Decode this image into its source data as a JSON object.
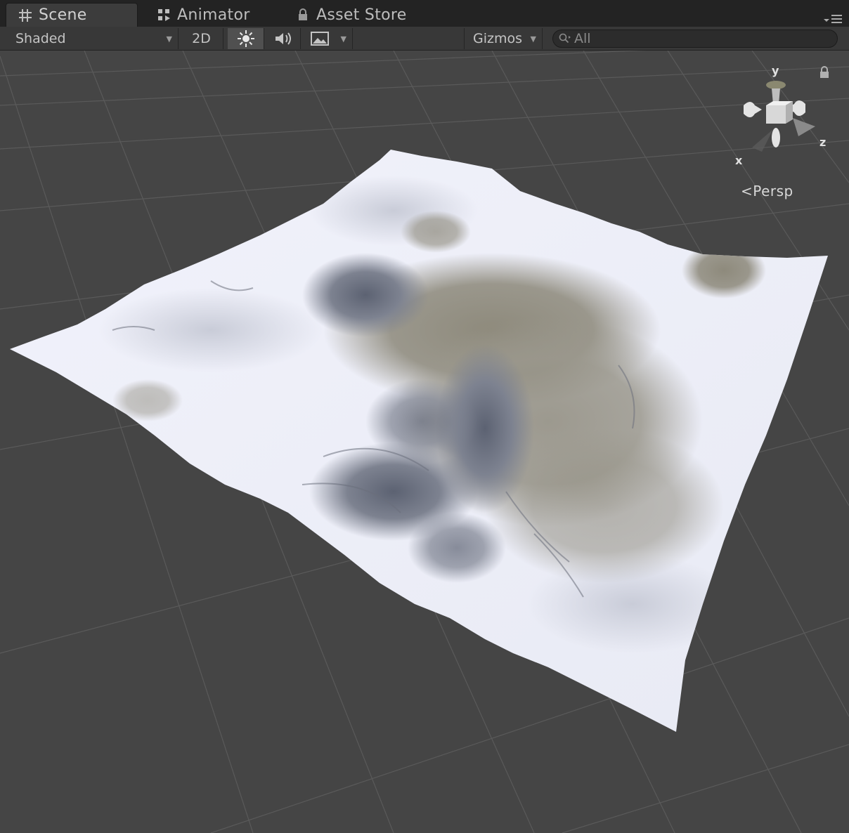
{
  "tabs": [
    {
      "label": "Scene",
      "icon": "grid-icon",
      "active": true
    },
    {
      "label": "Animator",
      "icon": "animator-icon",
      "active": false
    },
    {
      "label": "Asset Store",
      "icon": "store-lock-icon",
      "active": false
    }
  ],
  "toolbar": {
    "shading_mode": "Shaded",
    "mode_2d": "2D",
    "lighting_icon": "sun-icon",
    "audio_icon": "speaker-icon",
    "effects_icon": "image-effects-icon",
    "gizmos_label": "Gizmos",
    "search_placeholder": "All"
  },
  "gizmo": {
    "axis_y": "y",
    "axis_x": "x",
    "axis_z": "z",
    "projection_label": "Persp"
  },
  "colors": {
    "background": "#454545",
    "grid_line": "#5a5a5a",
    "terrain_snow": "#eef0f8",
    "terrain_rock": "#8e8a7c"
  }
}
